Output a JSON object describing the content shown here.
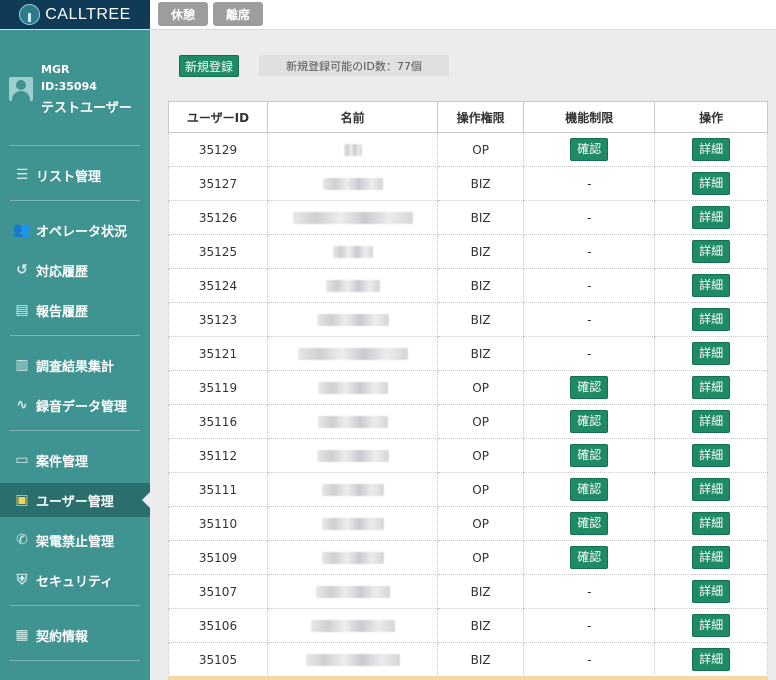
{
  "header": {
    "logo_text": "CALLTREE",
    "break_button": "休憩",
    "away_button": "離席"
  },
  "sidebar": {
    "role": "MGR",
    "user_id": "ID:35094",
    "user_name": "テストユーザー",
    "items": [
      {
        "label": "リスト管理",
        "icon": "list-icon"
      },
      {
        "label": "オペレータ状況",
        "icon": "operator-icon"
      },
      {
        "label": "対応履歴",
        "icon": "history-icon"
      },
      {
        "label": "報告履歴",
        "icon": "report-icon"
      },
      {
        "label": "調査結果集計",
        "icon": "survey-icon"
      },
      {
        "label": "録音データ管理",
        "icon": "waveform-icon"
      },
      {
        "label": "案件管理",
        "icon": "folder-icon"
      },
      {
        "label": "ユーザー管理",
        "icon": "id-card-icon",
        "active": true
      },
      {
        "label": "架電禁止管理",
        "icon": "phone-blocked-icon"
      },
      {
        "label": "セキュリティ",
        "icon": "shield-icon"
      },
      {
        "label": "契約情報",
        "icon": "contract-icon"
      }
    ]
  },
  "main": {
    "new_button": "新規登録",
    "id_count_text": "新規登録可能のID数：77個",
    "table": {
      "headers": [
        "ユーザーID",
        "名前",
        "操作権限",
        "機能制限",
        "操作"
      ],
      "confirm_label": "確認",
      "detail_label": "詳細",
      "rows": [
        {
          "id": "35129",
          "perm": "OP",
          "func": "confirm"
        },
        {
          "id": "35127",
          "perm": "BIZ",
          "func": "-"
        },
        {
          "id": "35126",
          "perm": "BIZ",
          "func": "-"
        },
        {
          "id": "35125",
          "perm": "BIZ",
          "func": "-"
        },
        {
          "id": "35124",
          "perm": "BIZ",
          "func": "-"
        },
        {
          "id": "35123",
          "perm": "BIZ",
          "func": "-"
        },
        {
          "id": "35121",
          "perm": "BIZ",
          "func": "-"
        },
        {
          "id": "35119",
          "perm": "OP",
          "func": "confirm"
        },
        {
          "id": "35116",
          "perm": "OP",
          "func": "confirm"
        },
        {
          "id": "35112",
          "perm": "OP",
          "func": "confirm"
        },
        {
          "id": "35111",
          "perm": "OP",
          "func": "confirm"
        },
        {
          "id": "35110",
          "perm": "OP",
          "func": "confirm"
        },
        {
          "id": "35109",
          "perm": "OP",
          "func": "confirm"
        },
        {
          "id": "35107",
          "perm": "BIZ",
          "func": "-"
        },
        {
          "id": "35106",
          "perm": "BIZ",
          "func": "-"
        },
        {
          "id": "35105",
          "perm": "BIZ",
          "func": "-"
        }
      ]
    }
  },
  "colors": {
    "sidebar_bg": "#3f9391",
    "sidebar_active": "#2a6f6d",
    "logo_bg": "#0f3b57",
    "button_green": "#1f8a66",
    "top_button_gray": "#9d9d9d"
  }
}
